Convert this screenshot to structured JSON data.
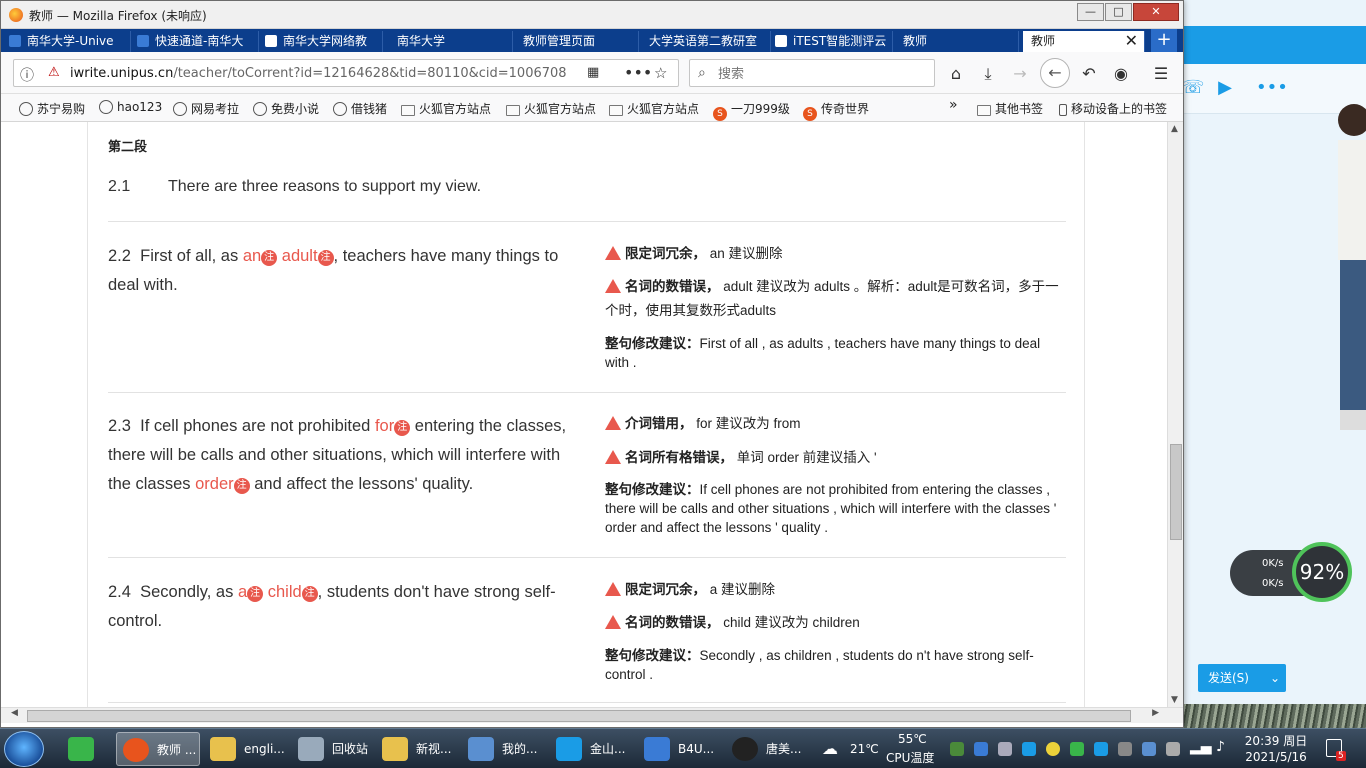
{
  "window": {
    "title": "教师 — Mozilla Firefox (未响应)",
    "buttons": {
      "minimize": "—",
      "maximize": "□",
      "close": "✕"
    }
  },
  "tabs": [
    {
      "label": "南华大学-Unive",
      "color": "#3a7bd5"
    },
    {
      "label": "快速通道-南华大",
      "color": "#3a7bd5"
    },
    {
      "label": "南华大学网络教",
      "color": "#ffffff"
    },
    {
      "label": "南华大学",
      "color": "#0c3e8c"
    },
    {
      "label": "教师管理页面",
      "color": "#0c3e8c"
    },
    {
      "label": "大学英语第二教研室",
      "color": "#0c3e8c"
    },
    {
      "label": "iTEST智能测评云",
      "color": "#ffffff"
    },
    {
      "label": "教师",
      "color": "#0c3e8c"
    },
    {
      "label": "教师",
      "color": "#ffffff",
      "active": true
    }
  ],
  "newtab": "+",
  "tab_close": "✕",
  "navbar": {
    "url_domain": "iwrite.unipus.cn",
    "url_path": "/teacher/toCorrent?id=12164628&tid=80110&cid=1006708",
    "search_placeholder": "搜索"
  },
  "bookmarks": [
    {
      "label": "苏宁易购",
      "icon": "globe"
    },
    {
      "label": "hao123",
      "icon": "globe"
    },
    {
      "label": "网易考拉",
      "icon": "globe"
    },
    {
      "label": "免费小说",
      "icon": "globe"
    },
    {
      "label": "借钱猪",
      "icon": "globe"
    },
    {
      "label": "火狐官方站点",
      "icon": "folder"
    },
    {
      "label": "火狐官方站点",
      "icon": "folder"
    },
    {
      "label": "火狐官方站点",
      "icon": "folder"
    },
    {
      "label": "一刀999级",
      "icon": "s"
    },
    {
      "label": "传奇世界",
      "icon": "s"
    }
  ],
  "bookmarks_right": [
    {
      "label": "其他书签"
    },
    {
      "label": "移动设备上的书签"
    }
  ],
  "bookmarks_overflow": "»",
  "doc": {
    "section_title": "第二段",
    "s21_num": "2.1",
    "s21_text": "There are three reasons to support my view.",
    "mark": "注",
    "s22": {
      "num": "2.2",
      "p1": "First of all, as ",
      "e1": "an",
      "p2": " ",
      "e2": "adult",
      "p3": ", teachers have many things to deal with.",
      "fb1_title": "限定词冗余，",
      "fb1_text": " an 建议删除",
      "fb2_title": "名词的数错误，",
      "fb2_text": " adult 建议改为 adults 。解析：adult是可数名词，多于一个时，使用其复数形式adults",
      "sugg_label": "整句修改建议：",
      "sugg_text": "First of all , as adults , teachers have many things to deal with ."
    },
    "s23": {
      "num": "2.3",
      "p1": "If cell phones are not prohibited ",
      "e1": "for",
      "p2": " entering the classes, there will be calls and other situations, which will interfere with the classes ",
      "e2": "order",
      "p3": " and affect the lessons' quality.",
      "fb1_title": "介词错用，",
      "fb1_text": " for 建议改为 from",
      "fb2_title": "名词所有格错误，",
      "fb2_text": " 单词 order 前建议插入 '",
      "sugg_label": "整句修改建议：",
      "sugg_text": "If cell phones are not prohibited from entering the classes , there will be calls and other situations , which will interfere with the classes ' order and affect the lessons ' quality ."
    },
    "s24": {
      "num": "2.4",
      "p1": "Secondly, as ",
      "e1": "a",
      "p2": " ",
      "e2": "child",
      "p3": ", students don't have strong self-control.",
      "fb1_title": "限定词冗余，",
      "fb1_text": " a 建议删除",
      "fb2_title": "名词的数错误，",
      "fb2_text": " child 建议改为 children",
      "sugg_label": "整句修改建议：",
      "sugg_text": "Secondly , as children , students do n't have strong self-control ."
    }
  },
  "side_panel": {
    "speed_up": "0K/s",
    "speed_down": "0K/s",
    "gauge": "92%",
    "send_button": "发送(S)"
  },
  "taskbar": {
    "items": [
      {
        "label": "教师 ...",
        "active": true,
        "color": "#e8541d"
      },
      {
        "label": "engli...",
        "color": "#e8c14d"
      },
      {
        "label": "回收站",
        "color": "#9ab"
      },
      {
        "label": "新视...",
        "color": "#e8c14d"
      },
      {
        "label": "我的...",
        "color": "#5a8fd0"
      },
      {
        "label": "金山...",
        "color": "#1a9ce6"
      },
      {
        "label": "B4U...",
        "color": "#3a7bd5"
      },
      {
        "label": "唐美...",
        "color": "#222"
      }
    ],
    "weather_temp": "21℃",
    "cpu_temp": "55℃",
    "cpu_label": "CPU温度",
    "time": "20:39 周日",
    "date": "2021/5/16",
    "notify_count": "5"
  },
  "colors": {
    "error": "#e8584d",
    "tabbar": "#0c3e8c",
    "qq_blue": "#1a9ce6"
  }
}
